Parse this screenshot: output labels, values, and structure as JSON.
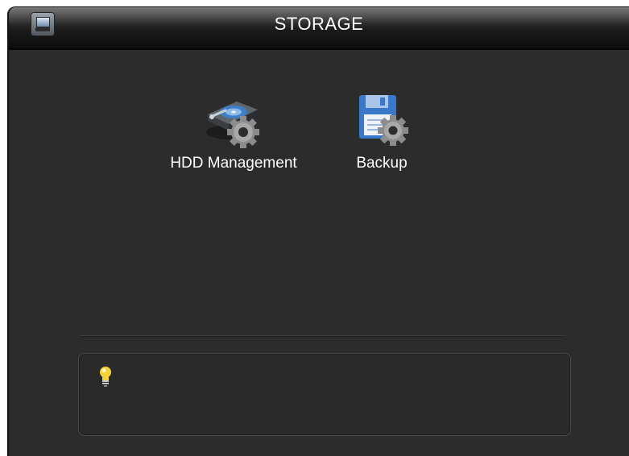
{
  "window": {
    "title": "STORAGE",
    "title_icon": "monitor-icon"
  },
  "menu": {
    "items": [
      {
        "label": "HDD Management",
        "icon": "hdd-gear-icon"
      },
      {
        "label": "Backup",
        "icon": "floppy-gear-icon"
      }
    ]
  },
  "tip": {
    "icon": "lightbulb-icon",
    "text": ""
  },
  "colors": {
    "background": "#2c2c2c",
    "titlebar": "#1b1b1b",
    "text": "#ffffff",
    "accent_blue": "#3d78c8",
    "gear": "#9a9a9a",
    "bulb": "#f2d23a"
  }
}
